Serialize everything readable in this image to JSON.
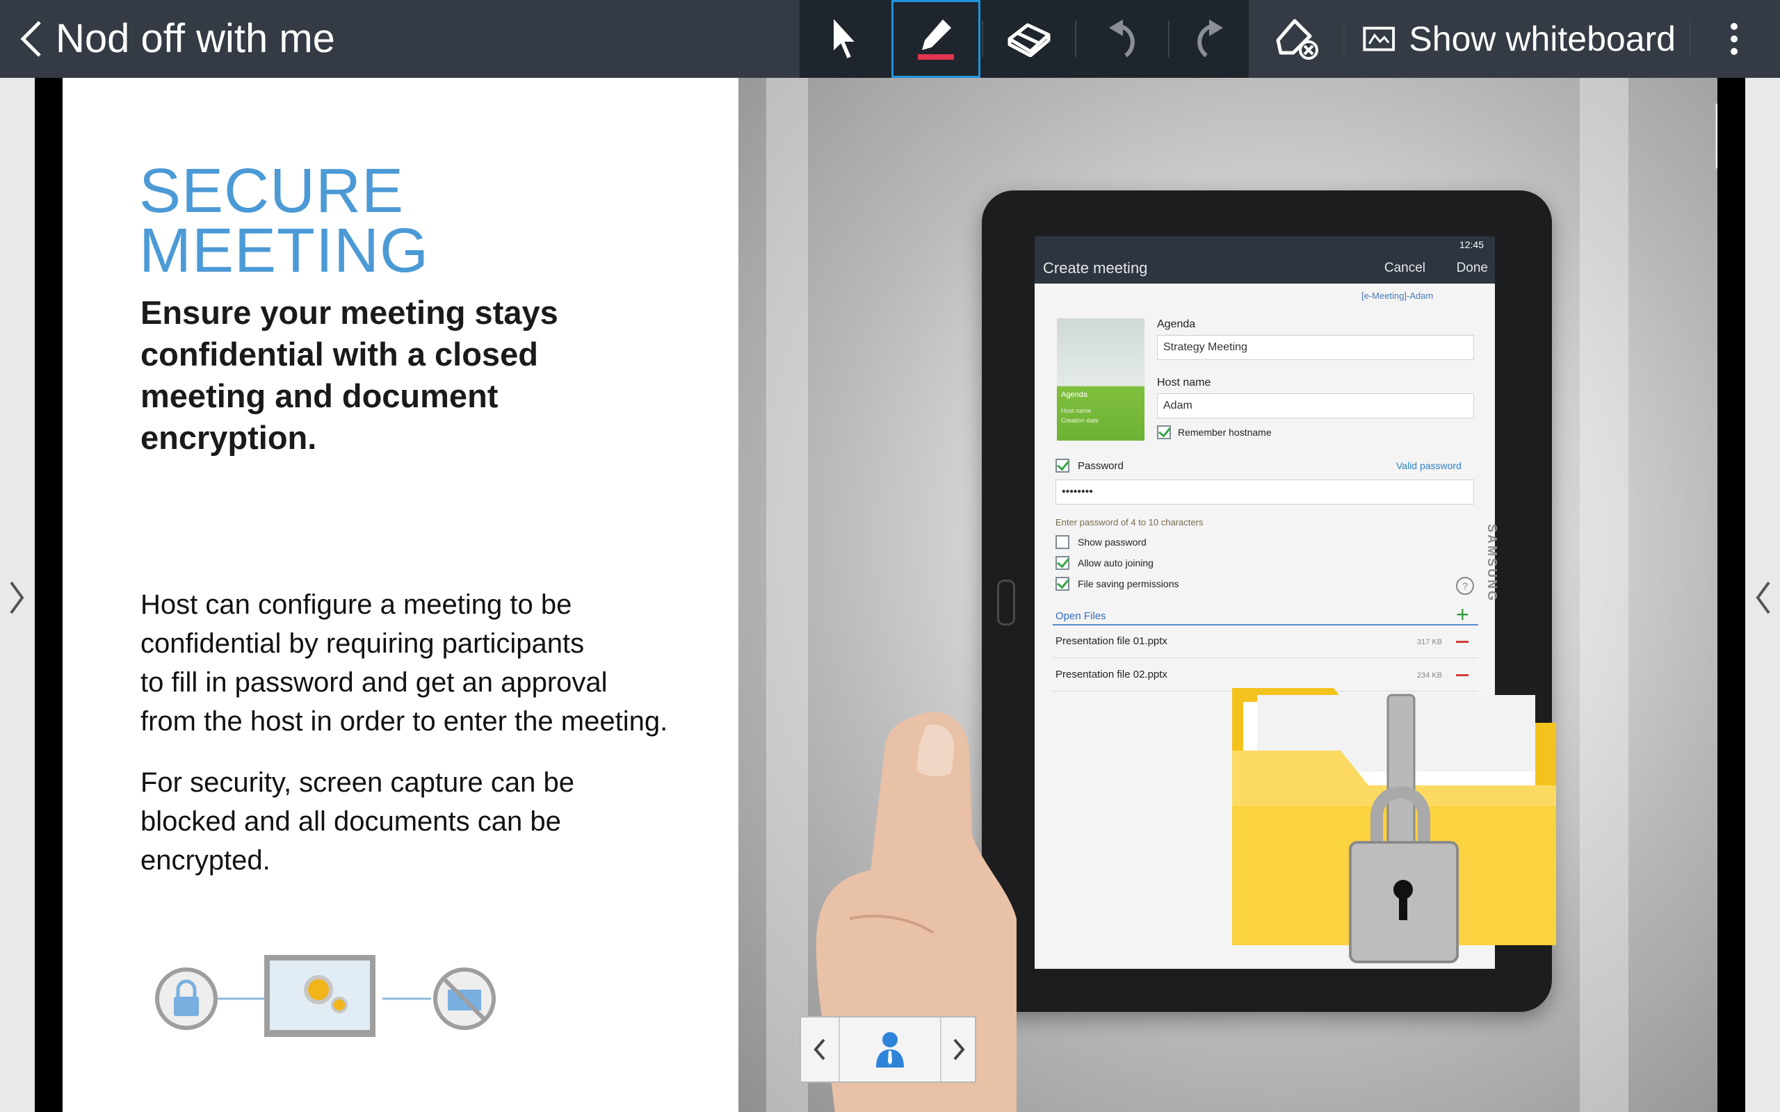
{
  "topbar": {
    "title": "Nod off with me",
    "show_whiteboard_label": "Show whiteboard"
  },
  "toolbar_icons": [
    "back-arrow-icon",
    "pointer-icon",
    "pen-icon",
    "eraser-icon",
    "undo-icon",
    "redo-icon",
    "clear-all-icon",
    "whiteboard-icon",
    "overflow-menu-icon"
  ],
  "colors": {
    "topbar": "#343b44",
    "tool_group": "#1f252c",
    "selected_tool_border": "#1e95dd",
    "pen_underline": "#e2344f",
    "headline": "#4b9ad6"
  },
  "slide": {
    "headline_line1": "SECURE",
    "headline_line2": "MEETING",
    "subhead": "Ensure your meeting stays confidential with a closed meeting and document encryption.",
    "para1": "Host  can configure a meeting  to be\nconfidential  by requiring participants\nto fill in password  and get an approval\nfrom the host in order to enter the meeting.",
    "para2": "For security,  screen capture  can be\nblocked  and all documents  can be\nencrypted."
  },
  "tablet_screen": {
    "status_time": "12:45",
    "title": "Create meeting",
    "cancel": "Cancel",
    "done": "Done",
    "network": "[e-Meeting]-Adam",
    "agenda_label": "Agenda",
    "agenda_value": "Strategy Meeting",
    "host_label": "Host name",
    "host_value": "Adam",
    "remember_hostname": "Remember hostname",
    "password_label": "Password",
    "valid_password": "Valid password",
    "password_value": "••••••••",
    "password_hint": "Enter password of 4 to 10 characters",
    "show_password": "Show password",
    "allow_auto_joining": "Allow auto joining",
    "file_saving_permissions": "File saving permissions",
    "open_files": "Open Files",
    "files": [
      {
        "name": "Presentation file 01.pptx",
        "size": "317 KB"
      },
      {
        "name": "Presentation file 02.pptx",
        "size": "234 KB"
      }
    ],
    "thumb_title": "Agenda",
    "thumb_line1": "Host name",
    "thumb_line2": "Creation date",
    "brand": "SAMSUNG"
  }
}
